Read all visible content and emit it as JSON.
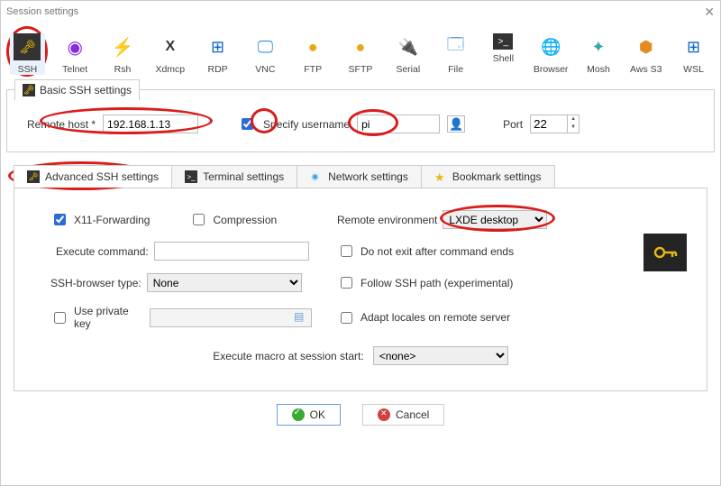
{
  "window": {
    "title": "Session settings"
  },
  "protocols": [
    {
      "id": "ssh",
      "label": "SSH",
      "selected": true
    },
    {
      "id": "telnet",
      "label": "Telnet"
    },
    {
      "id": "rsh",
      "label": "Rsh"
    },
    {
      "id": "xdmcp",
      "label": "Xdmcp"
    },
    {
      "id": "rdp",
      "label": "RDP"
    },
    {
      "id": "vnc",
      "label": "VNC"
    },
    {
      "id": "ftp",
      "label": "FTP"
    },
    {
      "id": "sftp",
      "label": "SFTP"
    },
    {
      "id": "serial",
      "label": "Serial"
    },
    {
      "id": "file",
      "label": "File"
    },
    {
      "id": "shell",
      "label": "Shell"
    },
    {
      "id": "browser",
      "label": "Browser"
    },
    {
      "id": "mosh",
      "label": "Mosh"
    },
    {
      "id": "awss3",
      "label": "Aws S3"
    },
    {
      "id": "wsl",
      "label": "WSL"
    }
  ],
  "basic": {
    "tab_label": "Basic SSH settings",
    "remote_host_label": "Remote host *",
    "remote_host_value": "192.168.1.13",
    "specify_username_label": "Specify username",
    "specify_username_checked": true,
    "username_value": "pi",
    "port_label": "Port",
    "port_value": "22"
  },
  "tabs": [
    {
      "id": "adv",
      "label": "Advanced SSH settings",
      "active": true
    },
    {
      "id": "term",
      "label": "Terminal settings"
    },
    {
      "id": "net",
      "label": "Network settings"
    },
    {
      "id": "book",
      "label": "Bookmark settings"
    }
  ],
  "advanced": {
    "x11_label": "X11-Forwarding",
    "x11_checked": true,
    "compression_label": "Compression",
    "compression_checked": false,
    "remote_env_label": "Remote environment",
    "remote_env_value": "LXDE desktop",
    "execute_cmd_label": "Execute command:",
    "execute_cmd_value": "",
    "no_exit_label": "Do not exit after command ends",
    "ssh_browser_label": "SSH-browser type:",
    "ssh_browser_value": "None",
    "follow_path_label": "Follow SSH path (experimental)",
    "use_private_key_label": "Use private key",
    "use_private_key_checked": false,
    "private_key_value": "",
    "adapt_locales_label": "Adapt locales on remote server",
    "macro_label": "Execute macro at session start:",
    "macro_value": "<none>"
  },
  "buttons": {
    "ok": "OK",
    "cancel": "Cancel"
  },
  "icons": {
    "ssh": "🔑",
    "telnet": "💫",
    "rsh": "↯",
    "xdmcp": "X",
    "rdp": "🪟",
    "vnc": "🖥️",
    "ftp": "🌐",
    "sftp": "🌐",
    "serial": "🔌",
    "file": "📄",
    "shell": "▣",
    "browser": "🌍",
    "mosh": "✦",
    "awss3": "☁",
    "wsl": "🐧"
  }
}
